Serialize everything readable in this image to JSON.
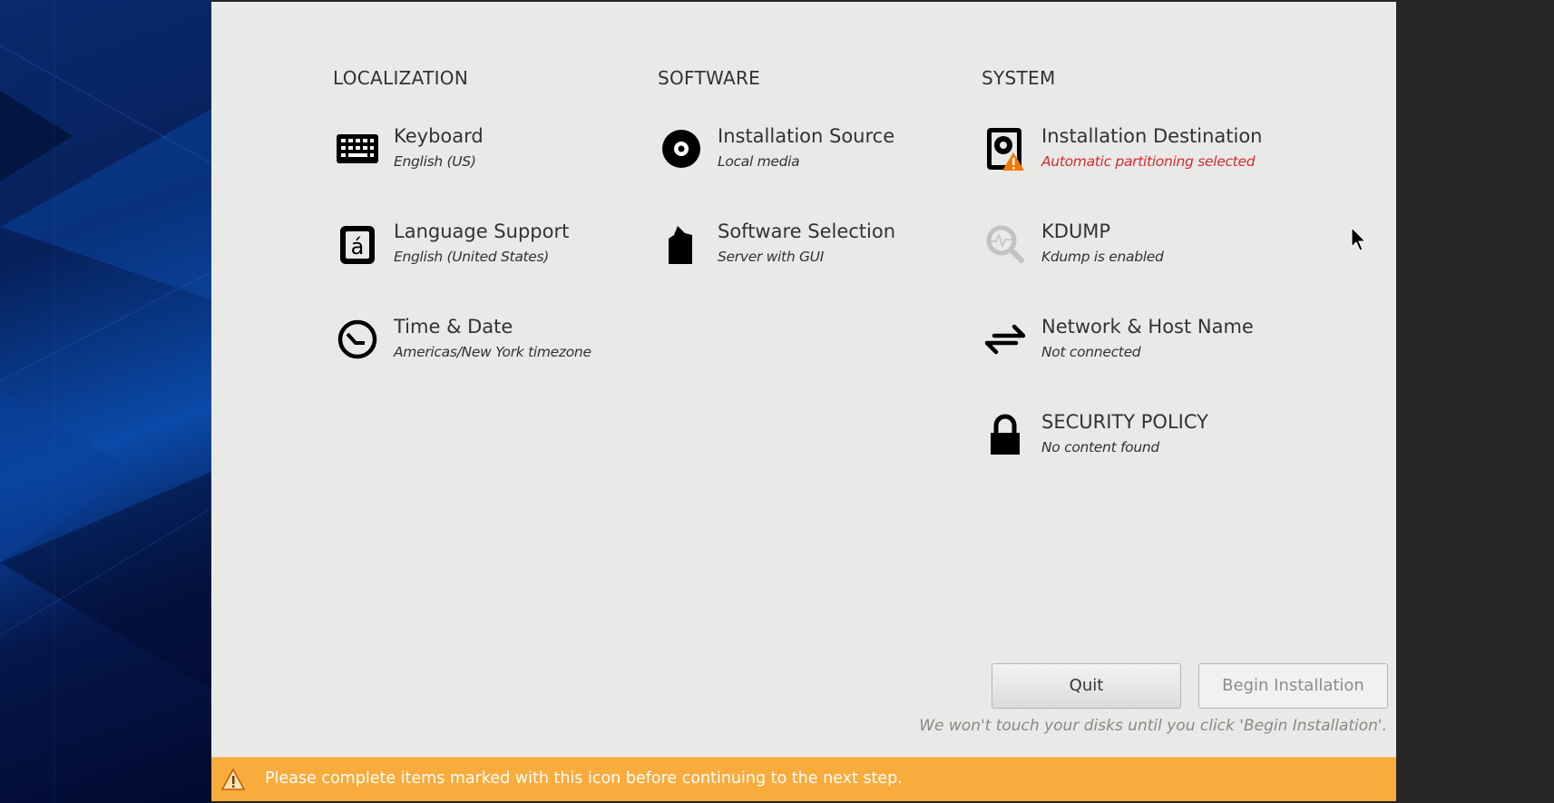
{
  "sections": {
    "localization": {
      "header": "LOCALIZATION",
      "items": [
        {
          "title": "Keyboard",
          "status": "English (US)",
          "icon": "keyboard-icon"
        },
        {
          "title": "Language Support",
          "status": "English (United States)",
          "icon": "language-icon"
        },
        {
          "title": "Time & Date",
          "status": "Americas/New York timezone",
          "icon": "clock-icon"
        }
      ]
    },
    "software": {
      "header": "SOFTWARE",
      "items": [
        {
          "title": "Installation Source",
          "status": "Local media",
          "icon": "disc-icon"
        },
        {
          "title": "Software Selection",
          "status": "Server with GUI",
          "icon": "package-icon"
        }
      ]
    },
    "system": {
      "header": "SYSTEM",
      "items": [
        {
          "title": "Installation Destination",
          "status": "Automatic partitioning selected",
          "icon": "harddisk-warning-icon",
          "warning": true
        },
        {
          "title": "KDUMP",
          "status": "Kdump is enabled",
          "icon": "kdump-search-icon"
        },
        {
          "title": "Network & Host Name",
          "status": "Not connected",
          "icon": "network-arrows-icon"
        },
        {
          "title": "SECURITY POLICY",
          "status": "No content found",
          "icon": "lock-icon"
        }
      ]
    }
  },
  "buttons": {
    "quit": "Quit",
    "begin": "Begin Installation"
  },
  "note": "We won't touch your disks until you click 'Begin Installation'.",
  "warning_bar": {
    "message": "Please complete items marked with this icon before continuing to the next step.",
    "icon": "warning-icon"
  },
  "colors": {
    "warning_bar": "#f9ab3c",
    "warning_text": "#d52c2c",
    "sidebar": "#0b3a8a"
  }
}
